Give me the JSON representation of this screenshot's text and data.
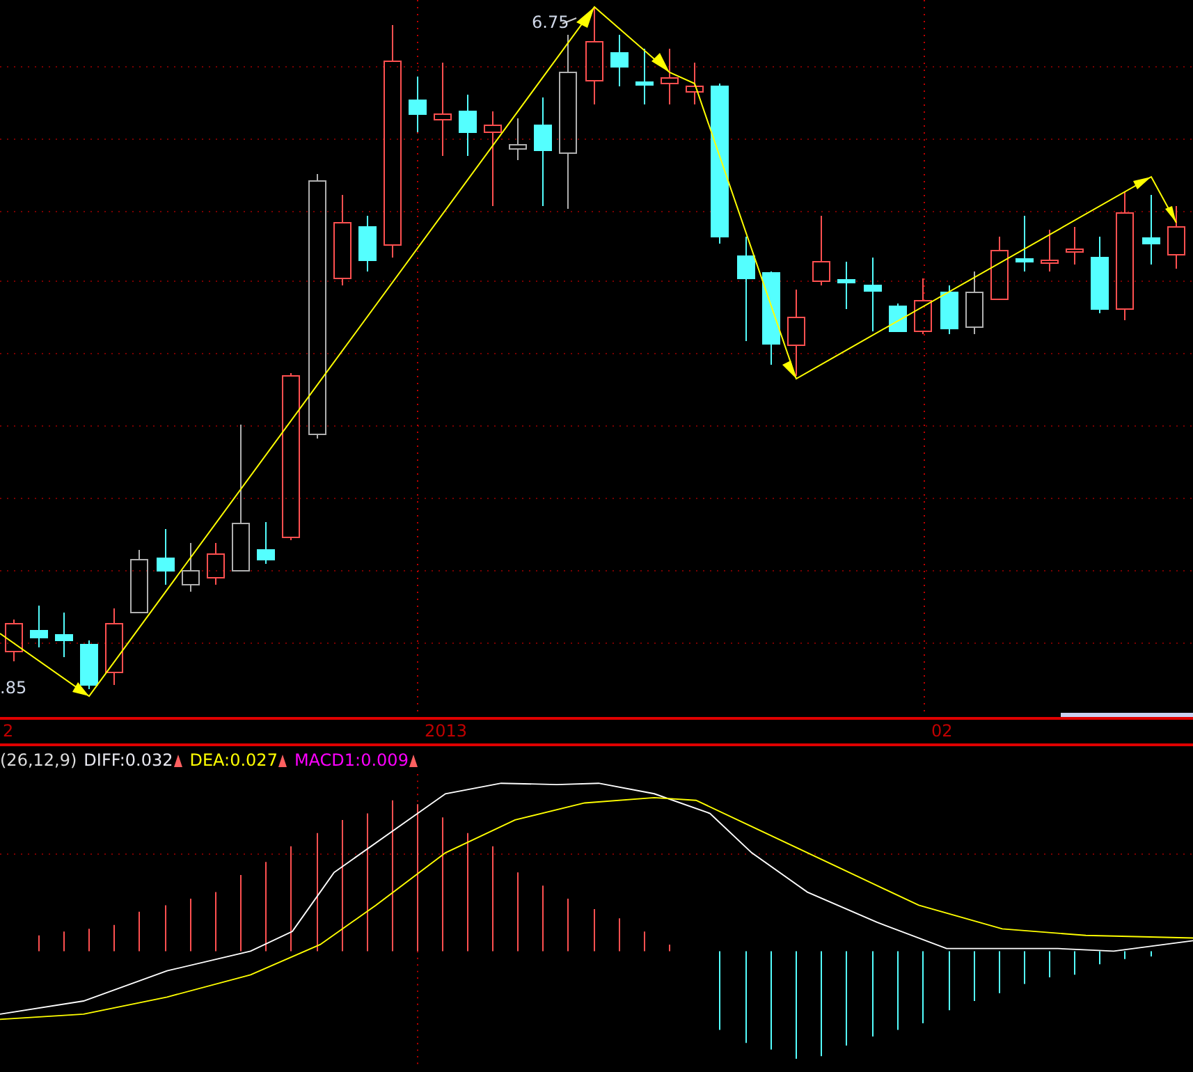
{
  "price_chart": {
    "peak_label": "6.75",
    "low_label": ".85"
  },
  "time_axis": {
    "labels": [
      "2",
      "2013",
      "02"
    ]
  },
  "macd_legend": [
    {
      "text": "(26,12,9)",
      "color": "#dcdcdc",
      "arrow": false
    },
    {
      "text": "DIFF:0.032",
      "color": "#e8e8f0",
      "arrow": true
    },
    {
      "text": "DEA:0.027",
      "color": "#ffff00",
      "arrow": true
    },
    {
      "text": "MACD1:0.009",
      "color": "#ff00ff",
      "arrow": true
    }
  ]
}
